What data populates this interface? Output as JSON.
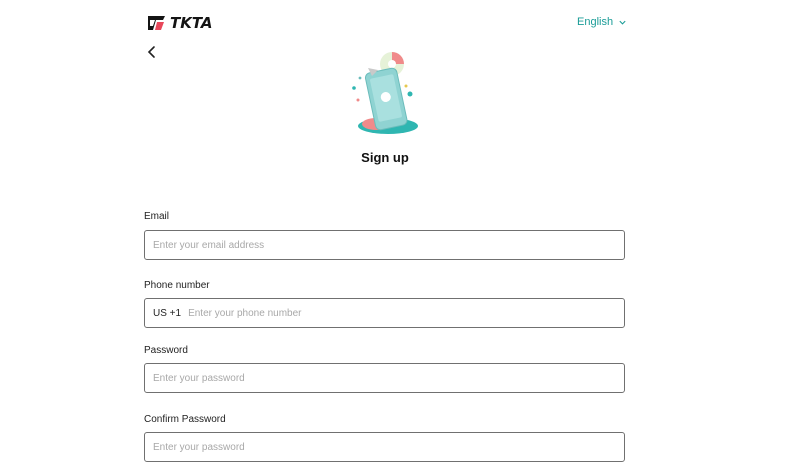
{
  "brand": {
    "name": "TKTA"
  },
  "header": {
    "language": "English"
  },
  "page": {
    "title": "Sign up"
  },
  "form": {
    "email": {
      "label": "Email",
      "placeholder": "Enter your email address",
      "value": ""
    },
    "phone": {
      "label": "Phone number",
      "country_code": "US +1",
      "placeholder": "Enter your phone number",
      "value": ""
    },
    "password": {
      "label": "Password",
      "placeholder": "Enter your password",
      "value": ""
    },
    "confirm_password": {
      "label": "Confirm Password",
      "placeholder": "Enter your password",
      "value": ""
    }
  },
  "icons": {
    "back": "chevron-left-icon",
    "language": "chevron-down-icon"
  },
  "colors": {
    "accent": "#1a9c97",
    "phone_illustration": "#8fd3d2",
    "shadow": "#2fb6b1",
    "highlight": "#f08a8a"
  }
}
